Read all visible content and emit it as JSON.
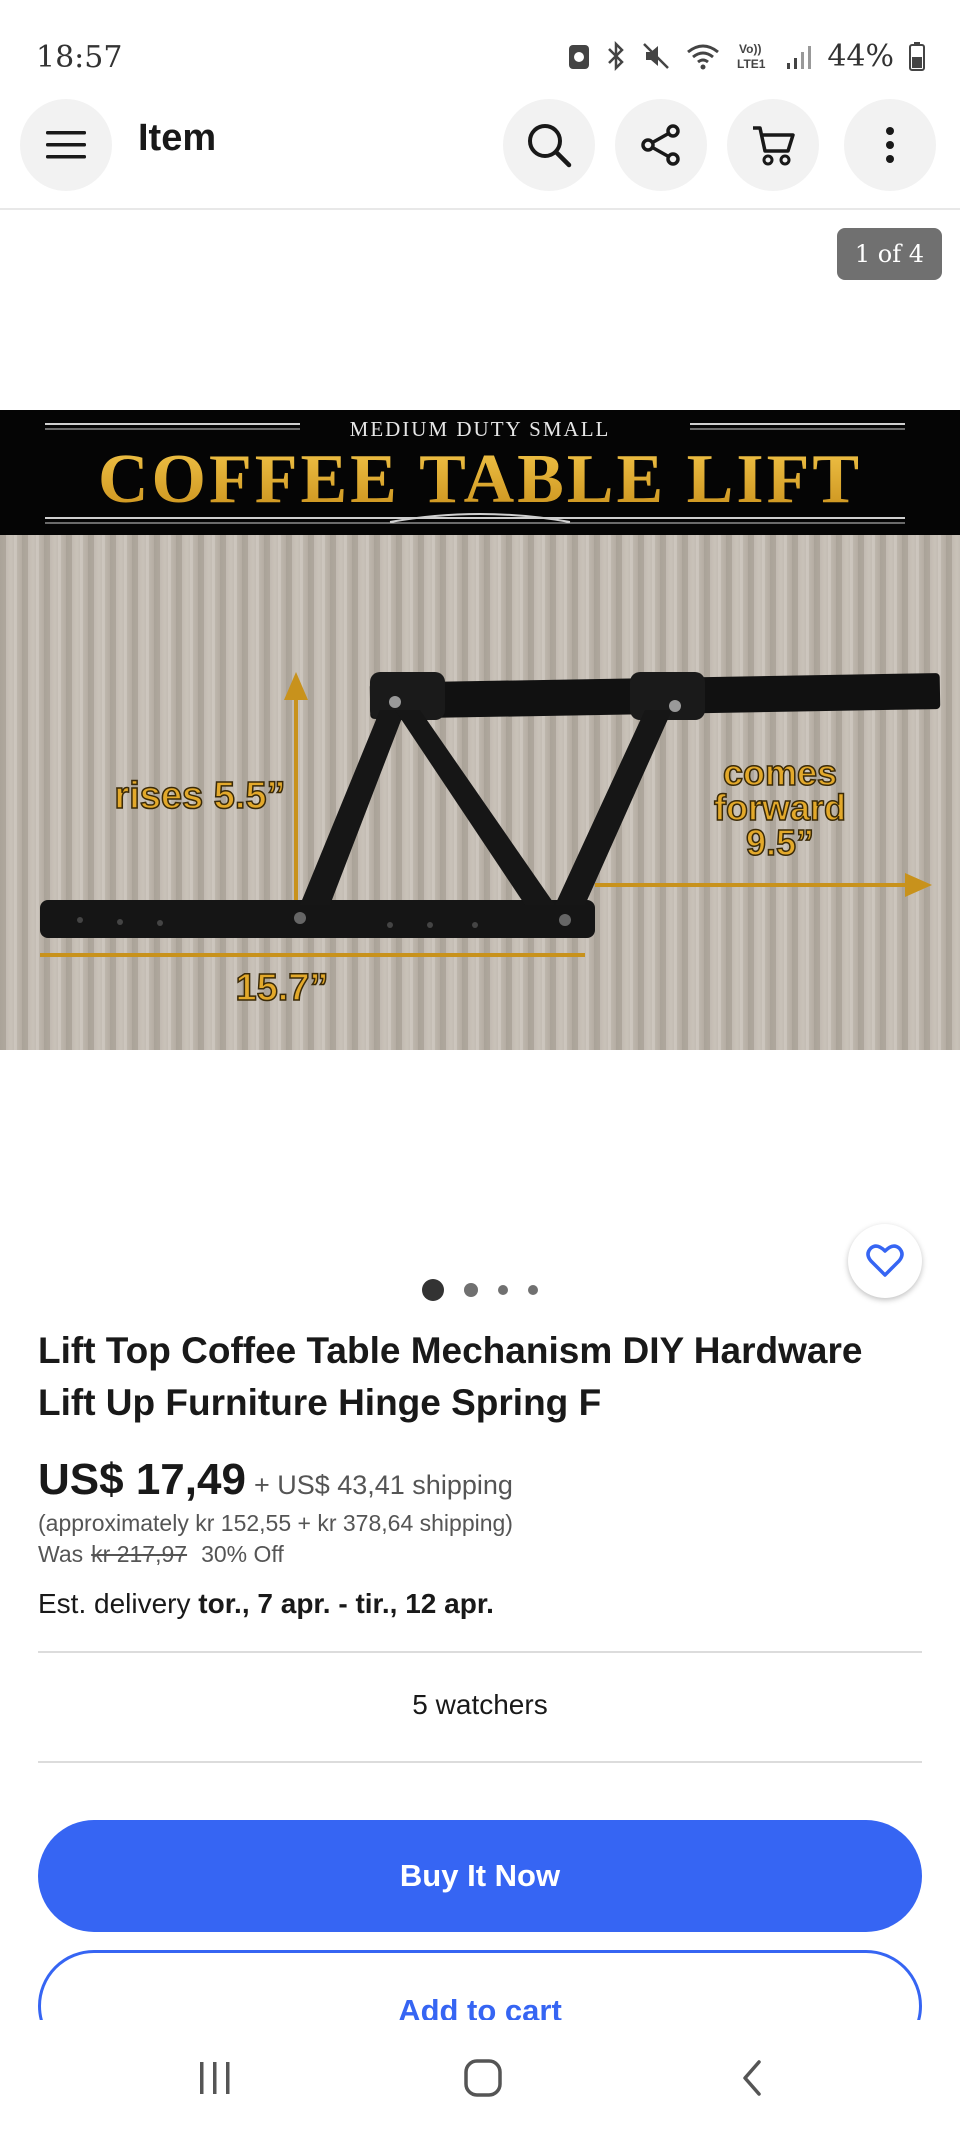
{
  "status_bar": {
    "time": "18:57",
    "battery": "44%",
    "network": "Vo)) LTE1"
  },
  "app_bar": {
    "title": "Item",
    "icons": [
      "menu-icon",
      "search-icon",
      "share-icon",
      "cart-icon",
      "more-icon"
    ]
  },
  "gallery": {
    "counter": "1 of 4",
    "image": {
      "header_small": "MEDIUM DUTY SMALL",
      "header_big": "COFFEE TABLE LIFT",
      "label_rises": "rises 5.5”",
      "label_forward_1": "comes",
      "label_forward_2": "forward",
      "label_forward_3": "9.5”",
      "label_length": "15.7”"
    },
    "dots_count": 4,
    "active_dot": 1
  },
  "item": {
    "title": "Lift Top Coffee Table Mechanism DIY Hardware Lift Up Furniture Hinge Spring F",
    "price": "US$ 17,49",
    "shipping": "+ US$ 43,41 shipping",
    "approx": "(approximately kr 152,55 + kr 378,64 shipping)",
    "was_label": "Was",
    "was_price": "kr 217,97",
    "discount": "30% Off",
    "delivery_label": "Est. delivery",
    "delivery_dates": "tor., 7 apr. - tir., 12 apr.",
    "watchers": "5 watchers"
  },
  "actions": {
    "buy_now": "Buy It Now",
    "add_to_cart": "Add to cart"
  },
  "colors": {
    "accent": "#3665f3",
    "text": "#191919",
    "muted": "#555555"
  }
}
